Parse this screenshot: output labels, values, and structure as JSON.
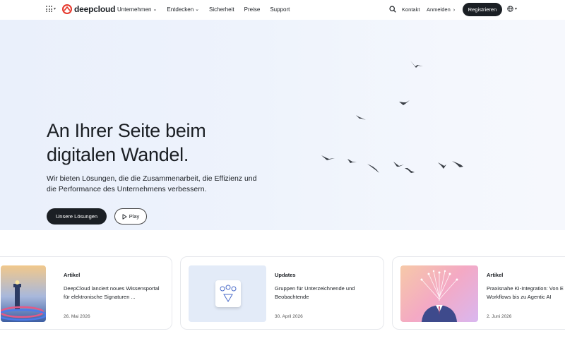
{
  "brand": {
    "name": "deepcloud",
    "accent": "#e5372b"
  },
  "nav": {
    "items": [
      {
        "label": "Unternehmen",
        "dropdown": true
      },
      {
        "label": "Entdecken",
        "dropdown": true
      },
      {
        "label": "Sicherheit",
        "dropdown": false
      },
      {
        "label": "Preise",
        "dropdown": false
      },
      {
        "label": "Support",
        "dropdown": false
      }
    ],
    "kontakt": "Kontakt",
    "anmelden": "Anmelden",
    "register": "Registrieren"
  },
  "hero": {
    "title_line1": "An Ihrer Seite beim",
    "title_line2": "digitalen Wandel.",
    "subtitle_line1": "Wir bieten Lösungen, die die Zusammenarbeit, die Effizienz und",
    "subtitle_line2": "die Performance des Unternehmens verbessern.",
    "primary_button": "Unsere Lösungen",
    "play_button": "Play"
  },
  "cards": [
    {
      "type": "Artikel",
      "text_line1": "DeepCloud lanciert noues Wissensportal",
      "text_line2": "für elektronische Signaturen ...",
      "date": "26. Mai 2026",
      "image": "lighthouse"
    },
    {
      "type": "Updates",
      "text_line1": "Gruppen für Unterzeichnende und",
      "text_line2": "Beobachtende",
      "date": "30. April 2026",
      "image": "group-signer-icon"
    },
    {
      "type": "Artikel",
      "text_line1": "Praxisnahe KI-Integration: Von E",
      "text_line2": "Workflows bis zu Agentic AI",
      "date": "2. Juni 2026",
      "image": "ai-person"
    }
  ]
}
